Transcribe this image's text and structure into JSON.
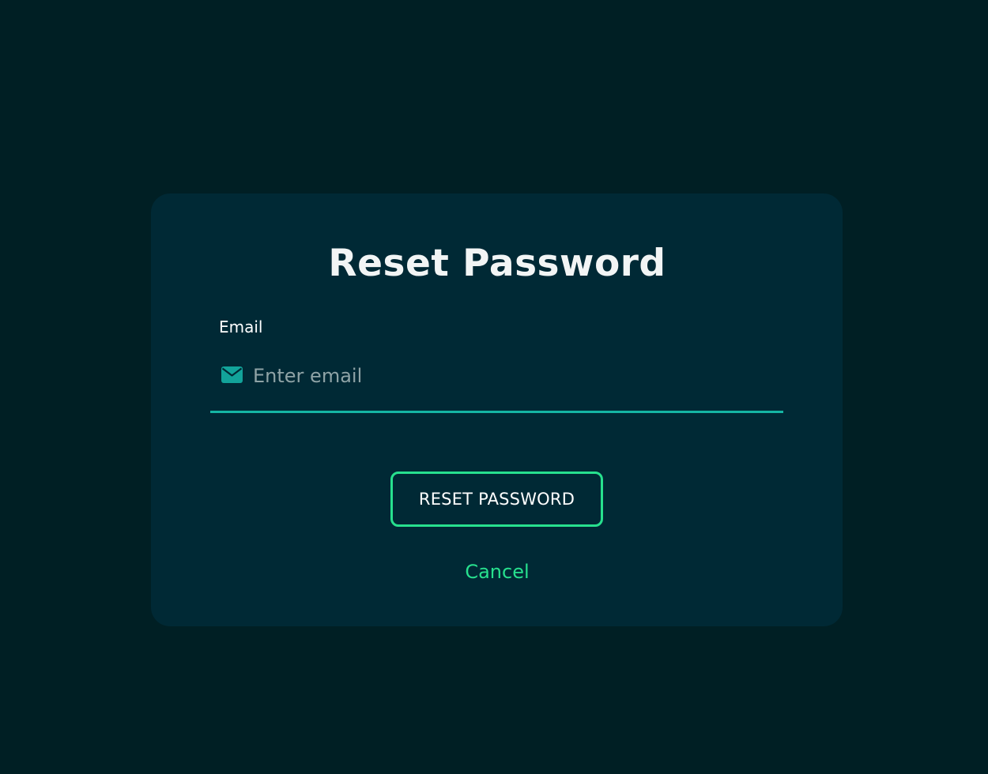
{
  "dialog": {
    "title": "Reset Password",
    "email_label": "Email",
    "email_placeholder": "Enter email",
    "email_value": "",
    "reset_button_label": "RESET PASSWORD",
    "cancel_label": "Cancel"
  },
  "icons": {
    "email_field_icon": "mail-icon"
  },
  "colors": {
    "page_background": "#001f24",
    "card_background": "#002935",
    "accent_green": "#27e08e",
    "input_underline_teal": "#15b5a3",
    "icon_teal": "#12a39a"
  }
}
